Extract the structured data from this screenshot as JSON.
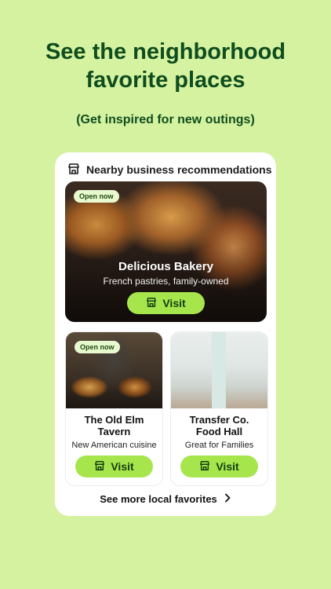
{
  "headline": {
    "line1": "See the neighborhood",
    "line2": "favorite places"
  },
  "subheadline": "(Get inspired for new outings)",
  "card": {
    "title": "Nearby business recommendations",
    "title_icon": "storefront-icon",
    "featured": {
      "badge": "Open now",
      "name": "Delicious Bakery",
      "description": "French pastries, family-owned",
      "button_label": "Visit",
      "button_icon": "storefront-icon"
    },
    "places": [
      {
        "badge": "Open now",
        "name_line1": "The Old Elm",
        "name_line2": "Tavern",
        "description": "New American cuisine",
        "button_label": "Visit",
        "button_icon": "storefront-icon"
      },
      {
        "name_line1": "Transfer Co.",
        "name_line2": "Food Hall",
        "description": "Great for Families",
        "button_label": "Visit",
        "button_icon": "storefront-icon"
      }
    ],
    "see_more_label": "See more local favorites",
    "see_more_icon": "chevron-right-icon"
  },
  "colors": {
    "background": "#d4f2a0",
    "headline": "#0f4d1e",
    "button": "#a6e64c",
    "badge": "#e9f9cf"
  }
}
